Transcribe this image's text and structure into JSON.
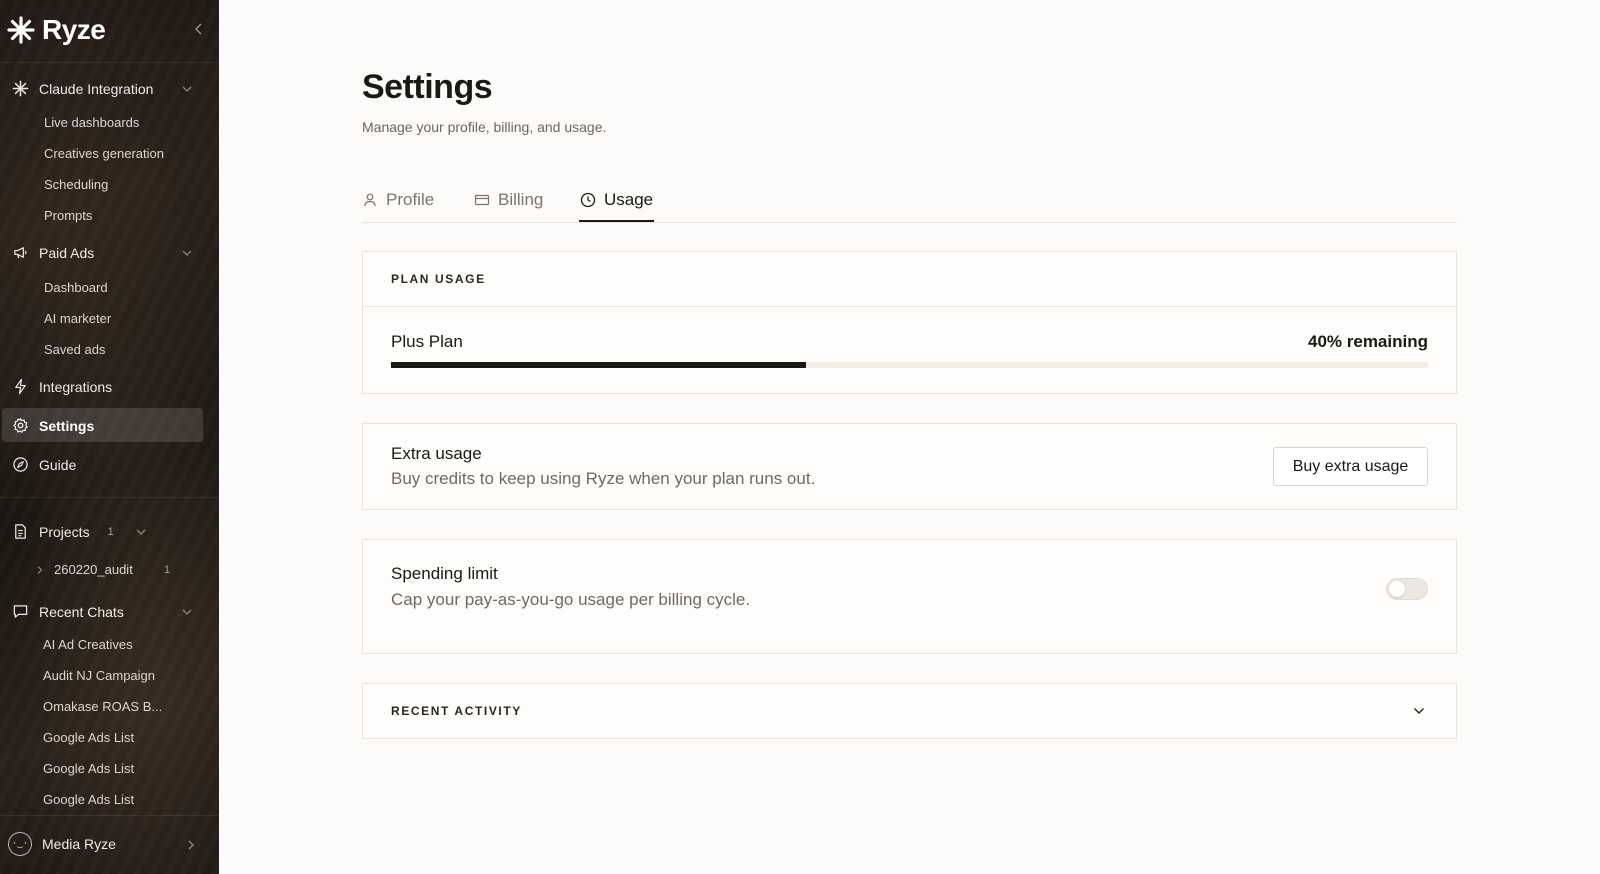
{
  "sidebar": {
    "brand": "Ryze",
    "sections": [
      {
        "label": "Claude Integration",
        "items": [
          "Live dashboards",
          "Creatives generation",
          "Scheduling",
          "Prompts"
        ]
      },
      {
        "label": "Paid Ads",
        "items": [
          "Dashboard",
          "AI marketer",
          "Saved ads"
        ]
      }
    ],
    "nav": {
      "integrations": "Integrations",
      "settings": "Settings",
      "guide": "Guide"
    },
    "projects": {
      "label": "Projects",
      "count": "1",
      "items": [
        {
          "name": "260220_audit",
          "count": "1"
        }
      ]
    },
    "recent_chats": {
      "label": "Recent Chats",
      "items": [
        "AI Ad Creatives",
        "Audit NJ Campaign",
        "Omakase ROAS B...",
        "Google Ads List",
        "Google Ads List",
        "Google Ads List"
      ]
    },
    "user": {
      "name": "Media Ryze",
      "avatar_text": "·‿·"
    }
  },
  "main": {
    "title": "Settings",
    "subtitle": "Manage your profile, billing, and usage.",
    "tabs": [
      {
        "label": "Profile",
        "icon": "user-icon"
      },
      {
        "label": "Billing",
        "icon": "card-icon"
      },
      {
        "label": "Usage",
        "icon": "clock-icon",
        "active": true
      }
    ],
    "plan_usage": {
      "header": "PLAN USAGE",
      "plan_name": "Plus Plan",
      "remaining_label": "40% remaining",
      "used_fraction": 0.4
    },
    "extra_usage": {
      "title": "Extra usage",
      "description": "Buy credits to keep using Ryze when your plan runs out.",
      "button_label": "Buy extra usage"
    },
    "spending_limit": {
      "title": "Spending limit",
      "description": "Cap your pay-as-you-go usage per billing cycle.",
      "enabled": false
    },
    "recent_activity": {
      "header": "RECENT ACTIVITY"
    }
  },
  "colors": {
    "accent": "#1b1916",
    "sidebar_bg": "#1f1813",
    "page_bg": "#fcfbf9"
  }
}
